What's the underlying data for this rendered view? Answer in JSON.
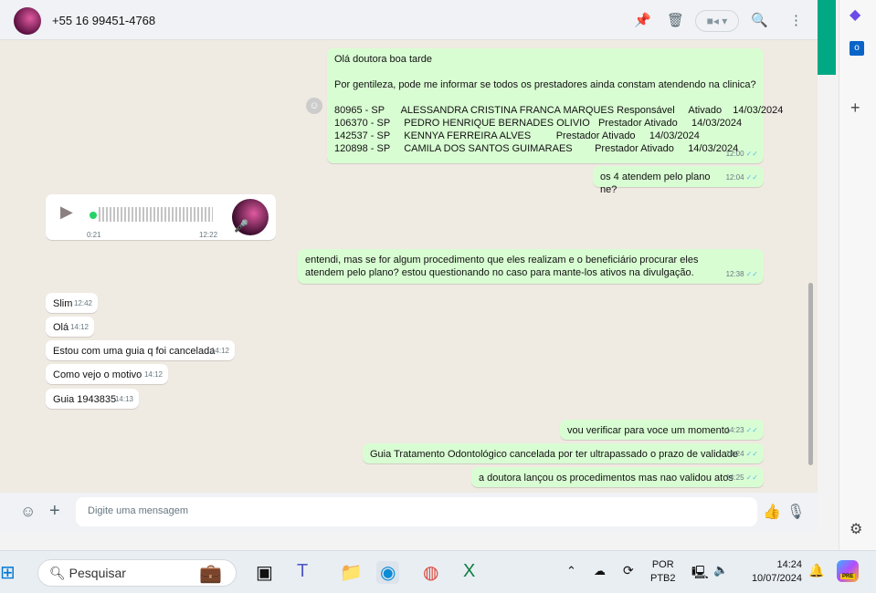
{
  "header": {
    "contact": "+55 16 99451-4768",
    "icons": [
      "pin-icon",
      "trash-icon",
      "video-call-icon",
      "search-icon",
      "menu-icon"
    ]
  },
  "messages": [
    {
      "dir": "out",
      "text": "Olá doutora boa tarde\n\nPor gentileza, pode me informar se todos os prestadores ainda constam atendendo na clinica?\n\n80965 - SP      ALESSANDRA CRISTINA FRANCA MARQUES Responsável     Ativado    14/03/2024\n106370 - SP     PEDRO HENRIQUE BERNADES OLIVIO   Prestador Ativado     14/03/2024\n142537 - SP     KENNYA FERREIRA ALVES         Prestador Ativado     14/03/2024\n120898 - SP     CAMILA DOS SANTOS GUIMARAES        Prestador Ativado     14/03/2024",
      "time": "12:00"
    },
    {
      "dir": "out",
      "text": "os 4 atendem pelo plano ne?",
      "time": "12:04"
    },
    {
      "dir": "in",
      "type": "audio",
      "duration": "0:21",
      "time": "12:22"
    },
    {
      "dir": "out",
      "text": "entendi, mas se for algum procedimento que eles realizam e o beneficiário procurar eles atendem pelo plano? estou questionando no caso para mante-los ativos na divulgação.",
      "time": "12:38"
    },
    {
      "dir": "in",
      "text": "Slim",
      "time": "12:42"
    },
    {
      "dir": "in",
      "text": "Olá",
      "time": "14:12"
    },
    {
      "dir": "in",
      "text": "Estou com uma guia q foi cancelada",
      "time": "14:12"
    },
    {
      "dir": "in",
      "text": "Como vejo o motivo",
      "time": "14:12"
    },
    {
      "dir": "in",
      "text": "Guia 1943835",
      "time": "14:13"
    },
    {
      "dir": "out",
      "text": "vou verificar para voce um momento",
      "time": "14:23"
    },
    {
      "dir": "out",
      "text": "Guia Tratamento Odontológico cancelada por ter ultrapassado o prazo de validade",
      "time": "14:24"
    },
    {
      "dir": "out",
      "text": "a doutora lançou os procedimentos mas nao validou atos",
      "time": "14:25"
    }
  ],
  "composer": {
    "placeholder": "Digite uma mensagem"
  },
  "taskbar": {
    "search": "Pesquisar",
    "lang1": "POR",
    "lang2": "PTB2",
    "time": "14:24",
    "date": "10/07/2024",
    "badge": "PRE"
  }
}
